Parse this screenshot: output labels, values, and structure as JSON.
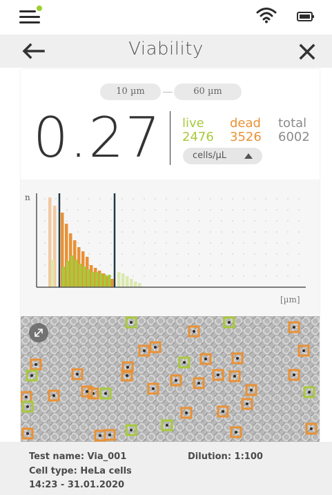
{
  "header": {
    "title": "Viability"
  },
  "range": {
    "min": "10 µm",
    "max": "60 µm"
  },
  "result": {
    "viability": "0.27",
    "live_label": "live",
    "live_value": "2476",
    "dead_label": "dead",
    "dead_value": "3526",
    "total_label": "total",
    "total_value": "6002",
    "unit": "cells/µL"
  },
  "histogram": {
    "y_label": "n",
    "x_label": "[µm]",
    "gate_lines": [
      "left-gate",
      "right-gate"
    ]
  },
  "footer": {
    "test_name": "Test name: Via_001",
    "dilution": "Dilution: 1:100",
    "cell_type": "Cell type: HeLa cells",
    "datetime": "14:23 - 31.01.2020"
  },
  "colors": {
    "accent_green": "#9bd02d",
    "live": "#a8c93b",
    "dead": "#e99135",
    "gate": "#1f3b45"
  },
  "icons": [
    "menu-icon",
    "notification-dot-icon",
    "wifi-icon",
    "battery-icon",
    "back-arrow-icon",
    "close-icon",
    "triangle-up-icon",
    "expand-icon"
  ]
}
